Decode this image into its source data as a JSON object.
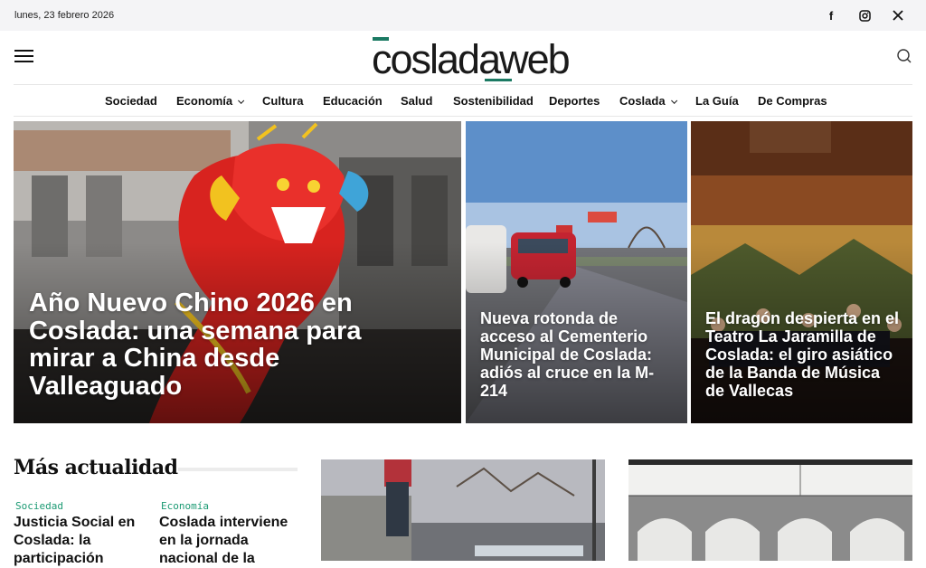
{
  "topbar": {
    "date": "lunes, 23 febrero 2026",
    "social": [
      {
        "name": "facebook",
        "glyph": "f"
      },
      {
        "name": "instagram",
        "glyph": "◎"
      },
      {
        "name": "x",
        "glyph": "𝕏"
      }
    ]
  },
  "header": {
    "logo": "cosladaweb"
  },
  "nav": {
    "items": [
      {
        "label": "Sociedad",
        "dropdown": false
      },
      {
        "label": "Economía",
        "dropdown": true
      },
      {
        "label": "Cultura",
        "dropdown": false
      },
      {
        "label": "Educación",
        "dropdown": false
      },
      {
        "label": "Salud",
        "dropdown": false
      },
      {
        "label": "Sostenibilidad",
        "dropdown": false
      },
      {
        "label": "Deportes",
        "dropdown": false
      },
      {
        "label": "Coslada",
        "dropdown": true
      },
      {
        "label": "La Guía",
        "dropdown": false
      },
      {
        "label": "De Compras",
        "dropdown": false
      }
    ]
  },
  "hero": [
    {
      "title": "Año Nuevo Chino 2026 en Coslada: una semana para mirar a China desde Valleaguado"
    },
    {
      "title": "Nueva rotonda de acceso al Cementerio Municipal de Coslada: adiós al cruce en la M-214"
    },
    {
      "title": "El dragón despierta en el Teatro La Jaramilla de Coslada: el giro asiático de la Banda de Música de Vallecas"
    }
  ],
  "section": {
    "title": "Más actualidad",
    "articles": [
      {
        "category": "Sociedad",
        "title": "Justicia Social en Coslada: la participación"
      },
      {
        "category": "Economía",
        "title": "Coslada interviene en la jornada nacional de la"
      }
    ]
  },
  "colors": {
    "accent": "#1b7a63",
    "category": "#1b9a73",
    "topbar_bg": "#f4f4f6"
  }
}
